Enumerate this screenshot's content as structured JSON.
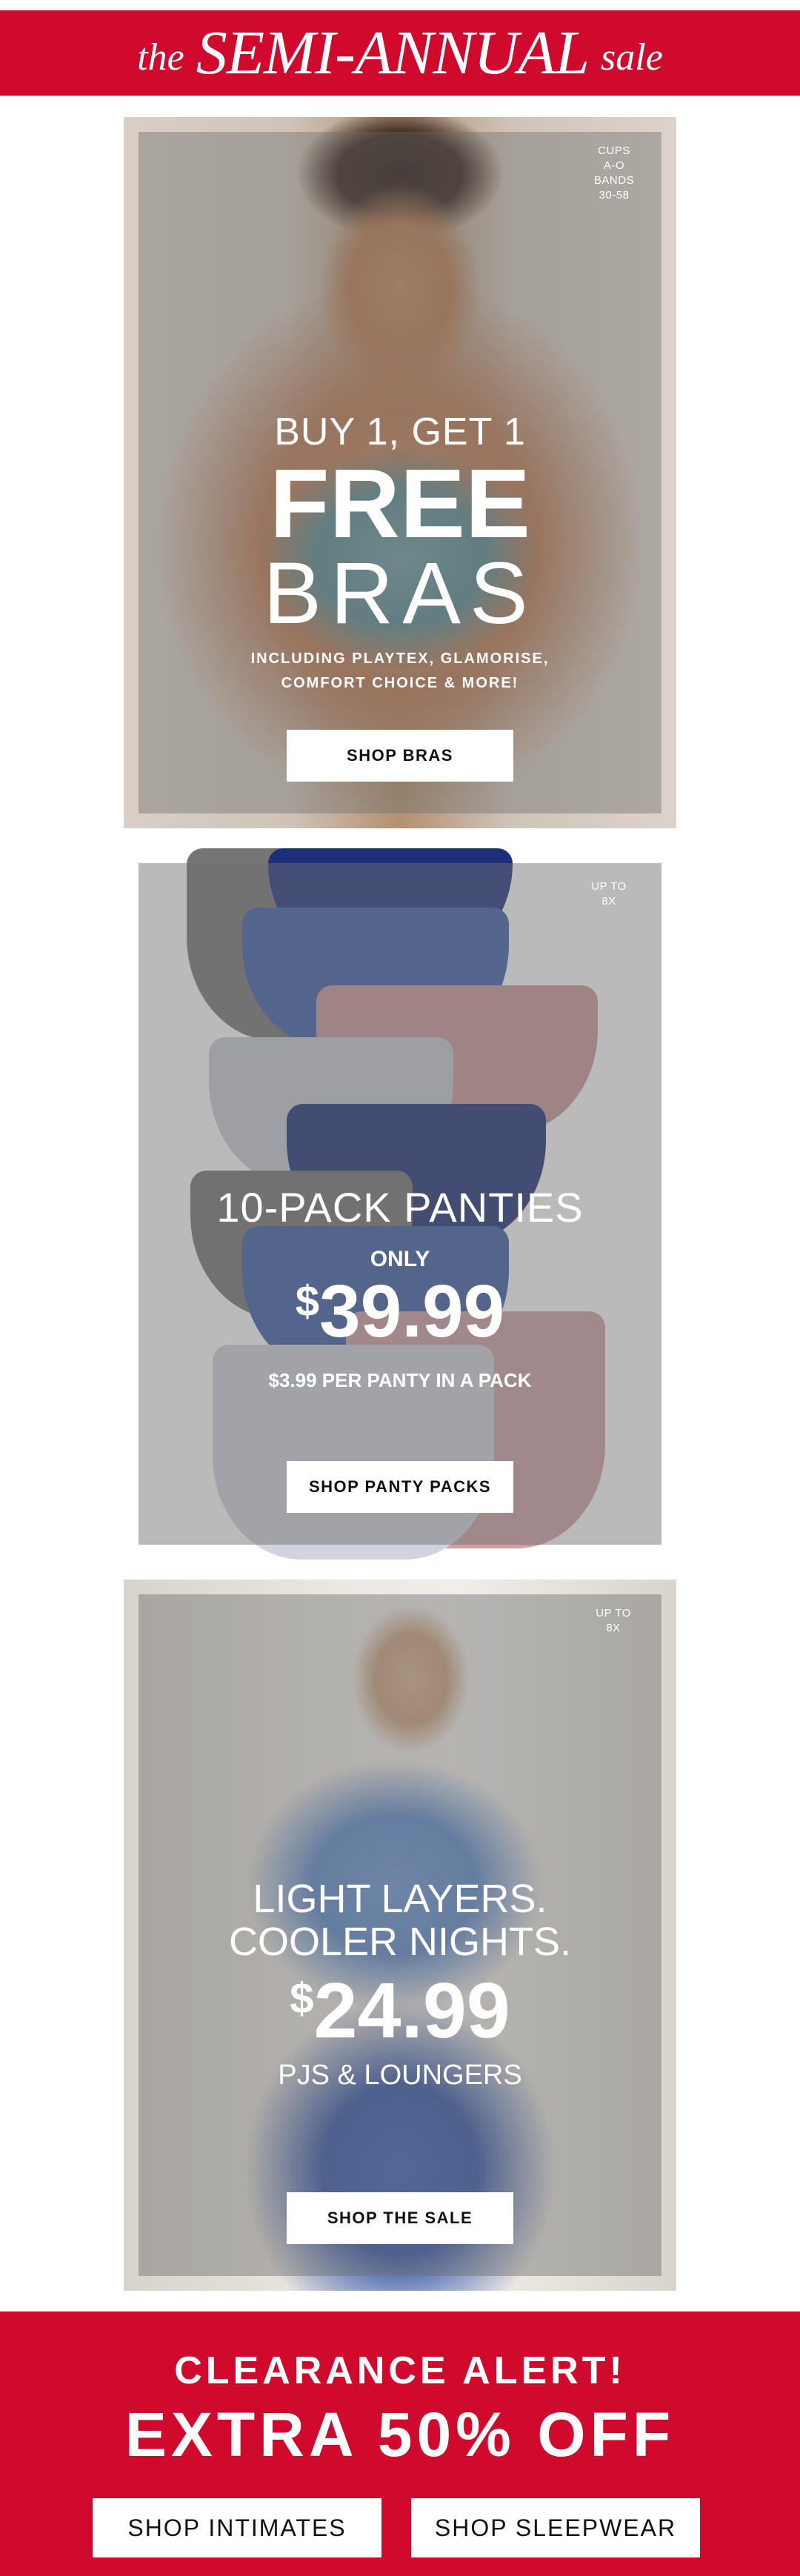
{
  "header": {
    "prefix": "the",
    "title": "SEMI-ANNUAL",
    "suffix": "sale"
  },
  "bras_panel": {
    "corner_note": [
      "CUPS",
      "A-O",
      "BANDS",
      "30-58"
    ],
    "line1": "BUY 1, GET 1",
    "line2": "FREE",
    "line3": "BRAS",
    "detail_line1": "INCLUDING PLAYTEX, GLAMORISE,",
    "detail_line2": "COMFORT CHOICE & MORE!",
    "button_label": "SHOP BRAS"
  },
  "panties_panel": {
    "corner_note": [
      "UP TO",
      "8X"
    ],
    "headline": "10-PACK PANTIES",
    "only_label": "ONLY",
    "price_symbol": "$",
    "price": "39.99",
    "subline": "$3.99 PER PANTY IN A PACK",
    "button_label": "SHOP PANTY PACKS"
  },
  "pjs_panel": {
    "corner_note": [
      "UP TO",
      "8X"
    ],
    "line1": "LIGHT LAYERS.",
    "line2": "COOLER NIGHTS.",
    "price_symbol": "$",
    "price": "24.99",
    "subline": "PJS & LOUNGERS",
    "button_label": "SHOP THE SALE"
  },
  "footer": {
    "alert": "CLEARANCE ALERT!",
    "offer": "EXTRA 50% OFF",
    "button_intimates": "SHOP INTIMATES",
    "button_sleepwear": "SHOP SLEEPWEAR"
  },
  "colors": {
    "brand_red": "#cf0a2c",
    "frame_beige": "#efd8c9",
    "button_bg": "#ffffff"
  }
}
